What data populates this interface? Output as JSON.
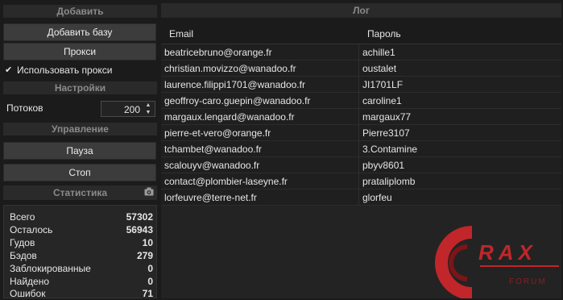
{
  "sections": {
    "add": "Добавить",
    "settings": "Настройки",
    "control": "Управление",
    "stats": "Статистика",
    "log": "Лог"
  },
  "buttons": {
    "add_base": "Добавить базу",
    "proxy": "Прокси",
    "pause": "Пауза",
    "stop": "Стоп"
  },
  "use_proxy": {
    "label": "Использовать прокси",
    "checked": true
  },
  "threads": {
    "label": "Потоков",
    "value": "200"
  },
  "stats": [
    {
      "label": "Всего",
      "value": "57302"
    },
    {
      "label": "Осталось",
      "value": "56943"
    },
    {
      "label": "Гудов",
      "value": "10"
    },
    {
      "label": "Бэдов",
      "value": "279"
    },
    {
      "label": "Заблокированные",
      "value": "0"
    },
    {
      "label": "Найдено",
      "value": "0"
    },
    {
      "label": "Ошибок",
      "value": "71"
    }
  ],
  "table": {
    "columns": [
      "Email",
      "Пароль"
    ],
    "rows": [
      {
        "email": "beatricebruno@orange.fr",
        "password": "achille1"
      },
      {
        "email": "christian.movizzo@wanadoo.fr",
        "password": "oustalet"
      },
      {
        "email": "laurence.filippi1701@wanadoo.fr",
        "password": "JI1701LF"
      },
      {
        "email": "geoffroy-caro.guepin@wanadoo.fr",
        "password": "caroline1"
      },
      {
        "email": "margaux.lengard@wanadoo.fr",
        "password": "margaux77"
      },
      {
        "email": "pierre-et-vero@orange.fr",
        "password": "Pierre3107"
      },
      {
        "email": "tchambet@wanadoo.fr",
        "password": "3.Contamine"
      },
      {
        "email": "scalouyv@wanadoo.fr",
        "password": "pbyv8601"
      },
      {
        "email": "contact@plombier-laseyne.fr",
        "password": "prataliplomb"
      },
      {
        "email": "lorfeuvre@terre-net.fr",
        "password": "glorfeu"
      }
    ]
  },
  "watermark": {
    "brand": "RAX",
    "sub": "FORUM",
    "color": "#c0262a"
  },
  "icons": {
    "camera": "camera-icon",
    "check": "check-icon",
    "spin_up": "chevron-up-icon",
    "spin_down": "chevron-down-icon"
  }
}
